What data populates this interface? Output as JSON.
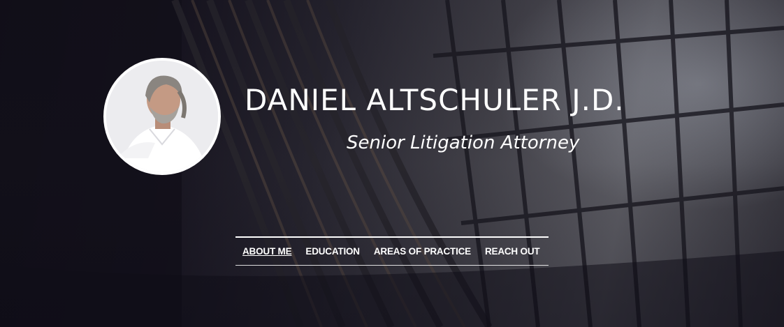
{
  "header": {
    "name": "DANIEL ALTSCHULER J.D.",
    "title": "Senior Litigation Attorney"
  },
  "avatar": {
    "icon": "portrait-photo"
  },
  "nav": {
    "items": [
      {
        "label": "ABOUT ME",
        "active": true
      },
      {
        "label": "EDUCATION",
        "active": false
      },
      {
        "label": "AREAS OF PRACTICE",
        "active": false
      },
      {
        "label": "REACH OUT",
        "active": false
      }
    ]
  },
  "colors": {
    "text": "#ffffff",
    "background_dark": "#15131c"
  }
}
